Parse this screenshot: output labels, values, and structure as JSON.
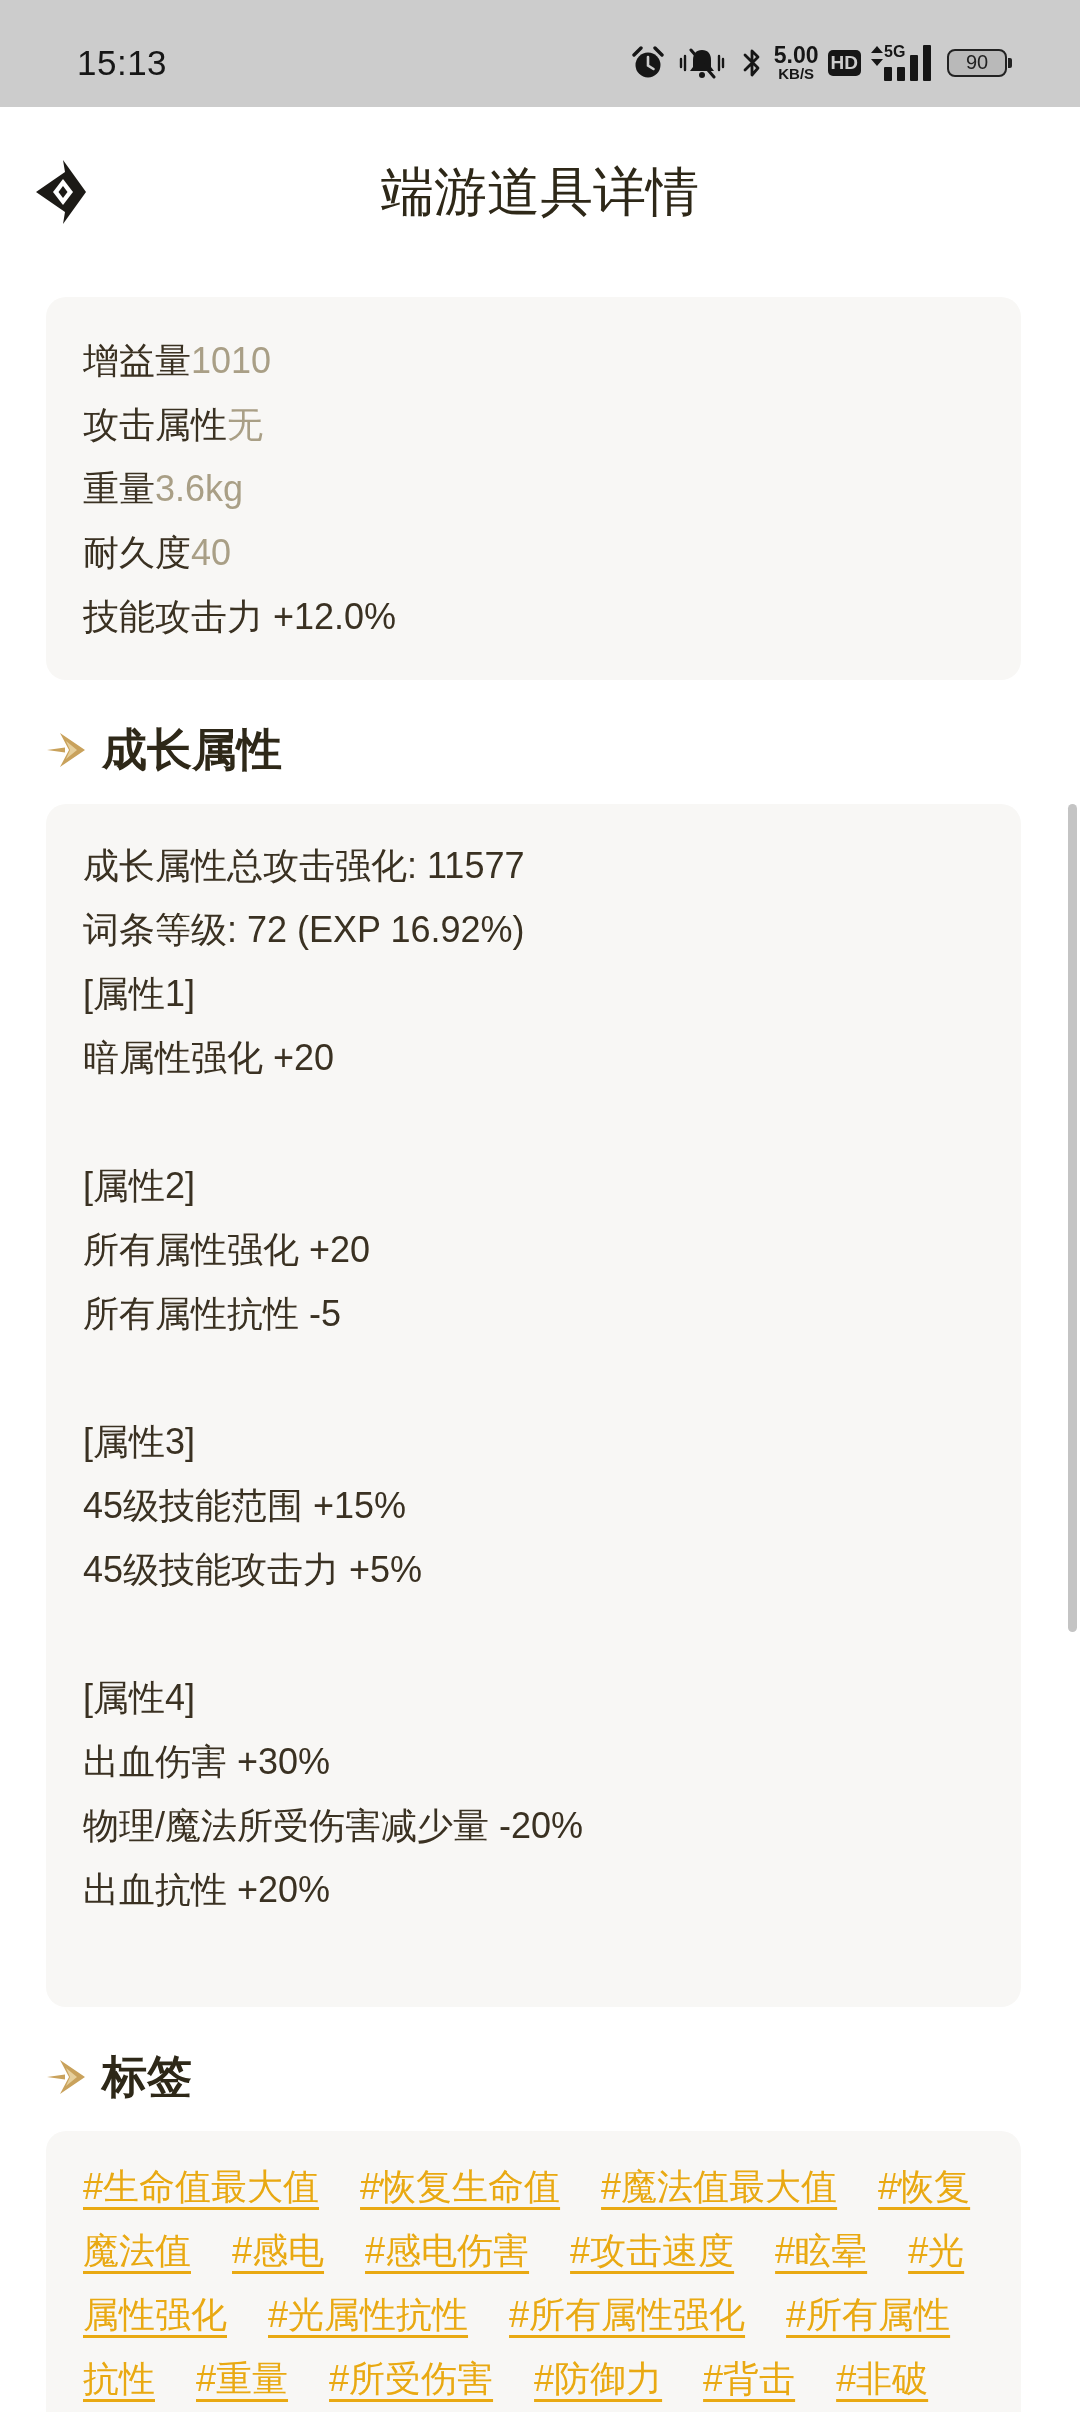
{
  "status_bar": {
    "time": "15:13",
    "net_speed": "5.00",
    "net_speed_unit": "KB/S",
    "hd_badge": "HD",
    "network_type": "5G",
    "battery": "90"
  },
  "header": {
    "title": "端游道具详情"
  },
  "basic_info": [
    {
      "label": "增益量",
      "value": "1010"
    },
    {
      "label": "攻击属性",
      "value": "无"
    },
    {
      "label": "重量",
      "value": "3.6kg"
    },
    {
      "label": "耐久度",
      "value": "40"
    },
    {
      "label": "技能攻击力 +12.0%"
    }
  ],
  "growth_attributes": {
    "title": "成长属性",
    "summary": [
      "成长属性总攻击强化: 11577",
      "词条等级: 72 (EXP 16.92%)"
    ],
    "groups": [
      {
        "label": "[属性1]",
        "effects": [
          "暗属性强化 +20"
        ]
      },
      {
        "label": "[属性2]",
        "effects": [
          "所有属性强化 +20",
          "所有属性抗性 -5"
        ]
      },
      {
        "label": "[属性3]",
        "effects": [
          "45级技能范围 +15%",
          "45级技能攻击力 +5%"
        ]
      },
      {
        "label": "[属性4]",
        "effects": [
          "出血伤害 +30%",
          "物理/魔法所受伤害减少量 -20%",
          "出血抗性 +20%"
        ]
      }
    ]
  },
  "tags": {
    "title": "标签",
    "items": [
      "#生命值最大值",
      "#恢复生命值",
      "#魔法值最大值",
      "#恢复魔法值",
      "#感电",
      "#感电伤害",
      "#攻击速度",
      "#眩晕",
      "#光属性强化",
      "#光属性抗性",
      "#所有属性强化",
      "#所有属性抗性",
      "#重量",
      "#所受伤害",
      "#防御力",
      "#背击",
      "#非破"
    ]
  }
}
